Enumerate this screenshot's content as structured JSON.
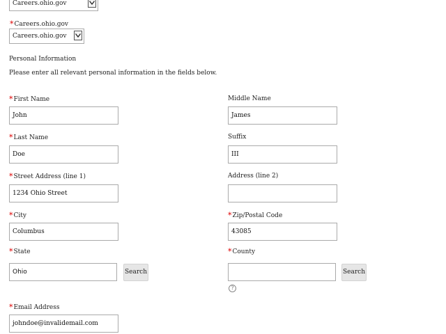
{
  "top_selects": [
    {
      "value": "Careers.ohio.gov"
    },
    {
      "label": "Careers.ohio.gov",
      "value": "Careers.ohio.gov"
    }
  ],
  "section": {
    "title": "Personal Information",
    "instructions": "Please enter all relevant personal information in the fields below."
  },
  "fields": {
    "first_name": {
      "label": "First Name",
      "value": "John",
      "required": true
    },
    "middle_name": {
      "label": "Middle Name",
      "value": "James",
      "required": false
    },
    "last_name": {
      "label": "Last Name",
      "value": "Doe",
      "required": true
    },
    "suffix": {
      "label": "Suffix",
      "value": "III",
      "required": false
    },
    "street1": {
      "label": "Street Address (line 1)",
      "value": "1234 Ohio Street",
      "required": true
    },
    "street2": {
      "label": "Address (line 2)",
      "value": "",
      "required": false
    },
    "city": {
      "label": "City",
      "value": "Columbus",
      "required": true
    },
    "zip": {
      "label": "Zip/Postal Code",
      "value": "43085",
      "required": true
    },
    "state": {
      "label": "State",
      "value": "Ohio",
      "required": true,
      "button": "Search"
    },
    "county": {
      "label": "County",
      "value": "",
      "required": true,
      "button": "Search"
    },
    "email": {
      "label": "Email Address",
      "value": "johndoe@invalidemail.com",
      "required": true
    }
  },
  "required_marker": "*",
  "help_icon": "?",
  "colors": {
    "required": "#dd0000",
    "button_bg": "#e6e6e6",
    "border": "#aaaaaa"
  }
}
